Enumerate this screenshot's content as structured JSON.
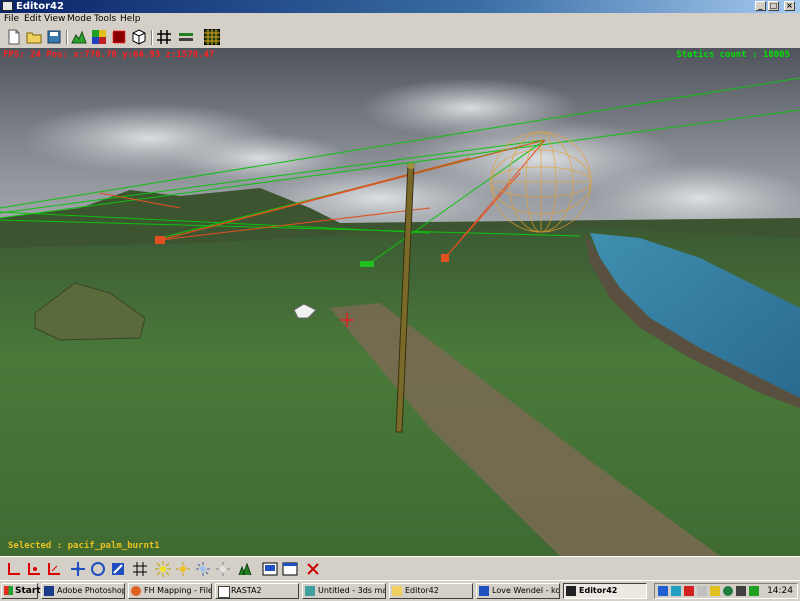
{
  "window": {
    "title": "Editor42"
  },
  "menu": {
    "items": [
      "File",
      "Edit",
      "View",
      "Mode",
      "Tools",
      "Help"
    ]
  },
  "viewport": {
    "fps_text": "FPS: 24  Pos: x:770.78  y:64.93  z:1578.47",
    "status_right": "Statics count : 18005",
    "selected_text": "Selected : pacif_palm_burnt1"
  },
  "taskbar": {
    "start_label": "Start",
    "tasks": [
      {
        "label": "Adobe Photoshop",
        "active": false
      },
      {
        "label": "FH Mapping - File...",
        "active": false
      },
      {
        "label": "RASTA2",
        "active": false
      },
      {
        "label": "Untitled - 3ds ma...",
        "active": false
      },
      {
        "label": "Editor42",
        "active": false
      },
      {
        "label": "Love Wendel - ko...",
        "active": false
      },
      {
        "label": "Editor42",
        "active": true
      }
    ],
    "clock": "14:24"
  },
  "colors": {
    "title_bar": "#0a246a",
    "hud_red": "#ff2020",
    "hud_green": "#00e000",
    "hud_yellow": "#e8c020"
  }
}
